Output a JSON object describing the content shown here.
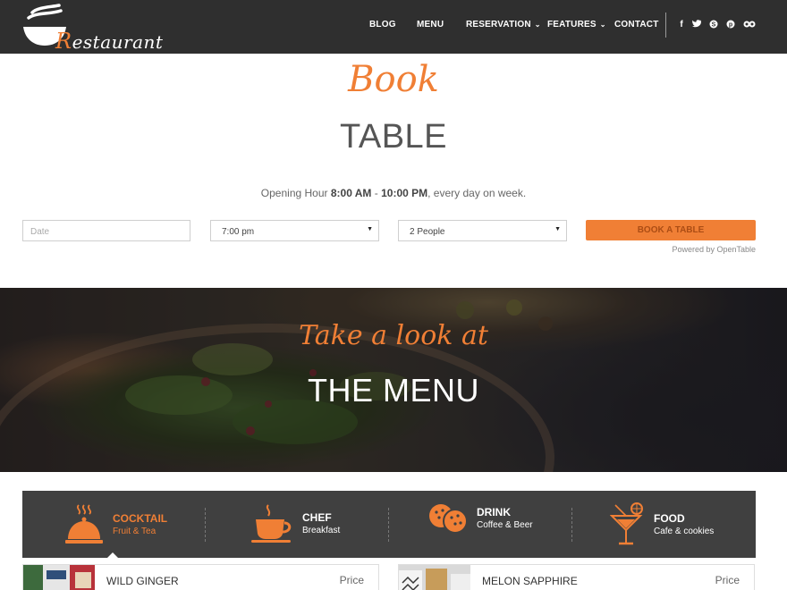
{
  "header": {
    "logo_text": "Restaurant",
    "nav": [
      {
        "label": "BLOG",
        "has_dropdown": false
      },
      {
        "label": "MENU",
        "has_dropdown": false
      },
      {
        "label": "RESERVATION",
        "has_dropdown": true
      },
      {
        "label": "FEATURES",
        "has_dropdown": true
      },
      {
        "label": "CONTACT",
        "has_dropdown": false
      }
    ],
    "social": [
      {
        "icon": "facebook-icon",
        "glyph": "f"
      },
      {
        "icon": "twitter-icon",
        "glyph": "t"
      },
      {
        "icon": "skype-icon",
        "glyph": "S"
      },
      {
        "icon": "pinterest-icon",
        "glyph": "P"
      },
      {
        "icon": "tripadvisor-icon",
        "glyph": "oo"
      }
    ]
  },
  "booking": {
    "script_title": "Book",
    "title": "TABLE",
    "opening_prefix": "Opening Hour ",
    "opening_start": "8:00 AM",
    "opening_sep": " - ",
    "opening_end": "10:00 PM",
    "opening_suffix": ", every day on week.",
    "date_placeholder": "Date",
    "time_value": "7:00 pm",
    "people_value": "2 People",
    "book_button": "BOOK A TABLE",
    "powered_by": "Powered by OpenTable"
  },
  "menu_hero": {
    "script_title": "Take a look at",
    "title": "THE MENU"
  },
  "categories": [
    {
      "title": "COCKTAIL",
      "subtitle": "Fruit & Tea",
      "icon": "cloche-icon",
      "active": true
    },
    {
      "title": "CHEF",
      "subtitle": "Breakfast",
      "icon": "coffee-cup-icon",
      "active": false
    },
    {
      "title": "DRINK",
      "subtitle": "Coffee & Beer",
      "icon": "cookies-icon",
      "active": false
    },
    {
      "title": "FOOD",
      "subtitle": "Cafe & cookies",
      "icon": "cocktail-glass-icon",
      "active": false
    }
  ],
  "menu_items": [
    {
      "name": "WILD GINGER",
      "price": "Price"
    },
    {
      "name": "MELON SAPPHIRE",
      "price": "Price"
    }
  ],
  "colors": {
    "accent": "#f07f35",
    "header_bg": "#2f2f2f",
    "tabs_bg": "#404040"
  }
}
